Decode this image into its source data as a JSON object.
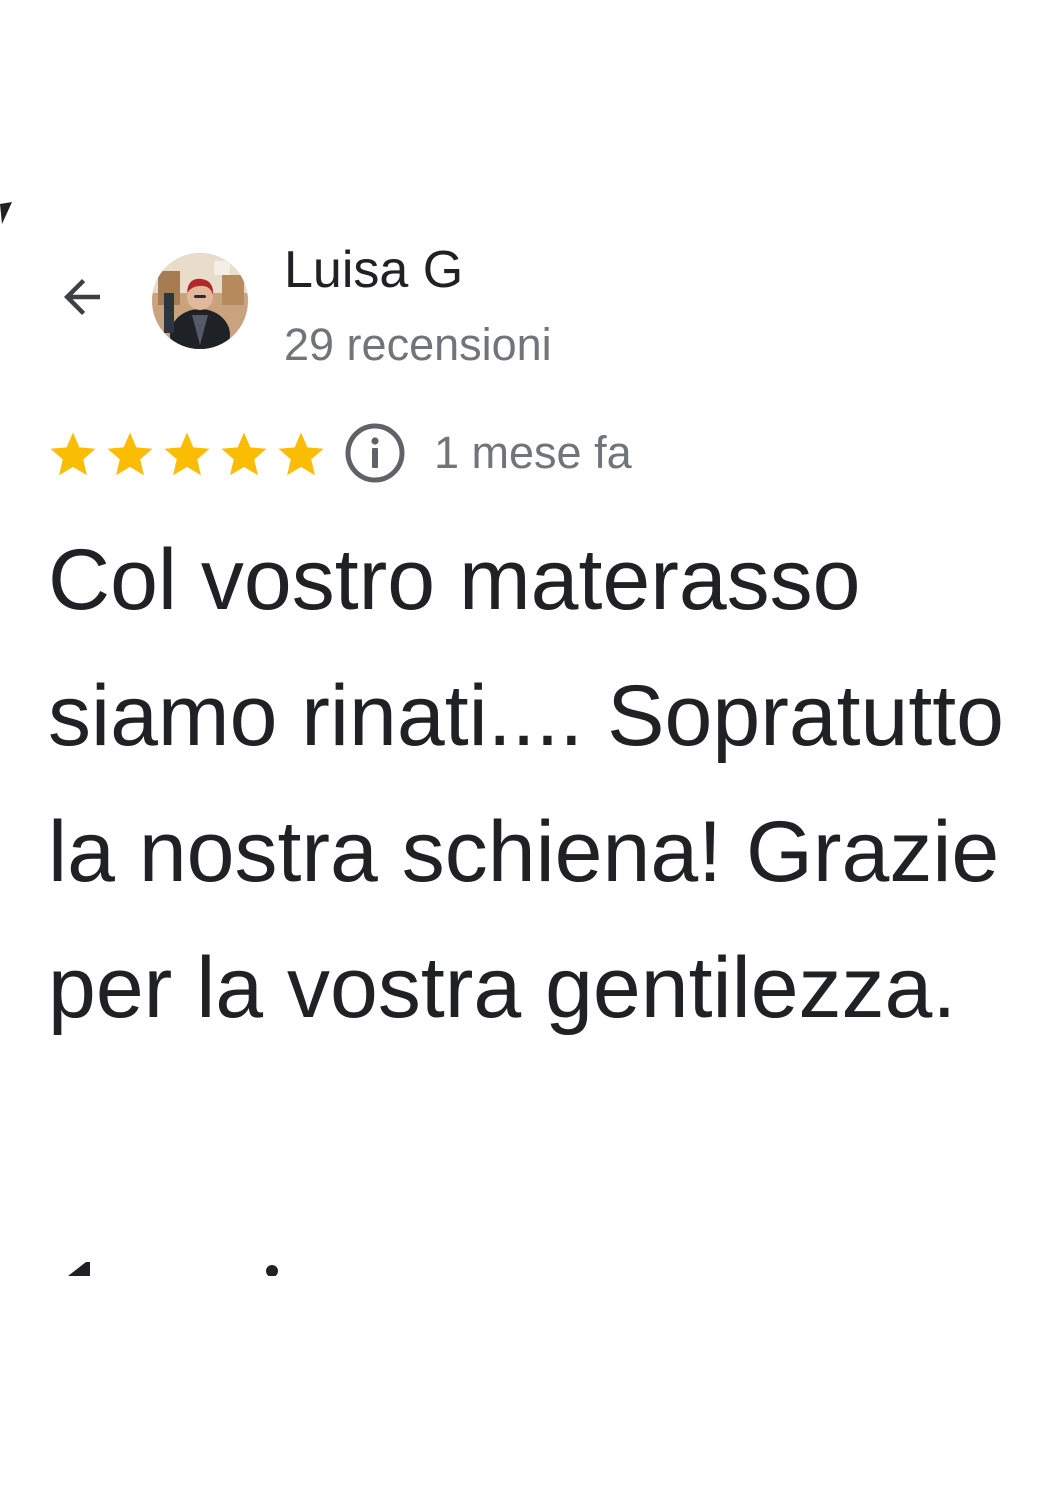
{
  "reviewer": {
    "name": "Luisa G",
    "review_count": "29 recensioni",
    "avatar": "profile-photo"
  },
  "rating": {
    "stars": 5,
    "max_stars": 5,
    "star_color": "#fbbc04"
  },
  "review": {
    "date": "1 mese fa",
    "text": "Col vostro materasso siamo rinati.... Sopratutto la nostra schiena! Grazie per la vostra gentilezza."
  },
  "icons": {
    "back": "arrow-back-icon",
    "info": "info-icon"
  },
  "colors": {
    "text_primary": "#202124",
    "text_secondary": "#70757a",
    "star": "#fbbc04"
  }
}
